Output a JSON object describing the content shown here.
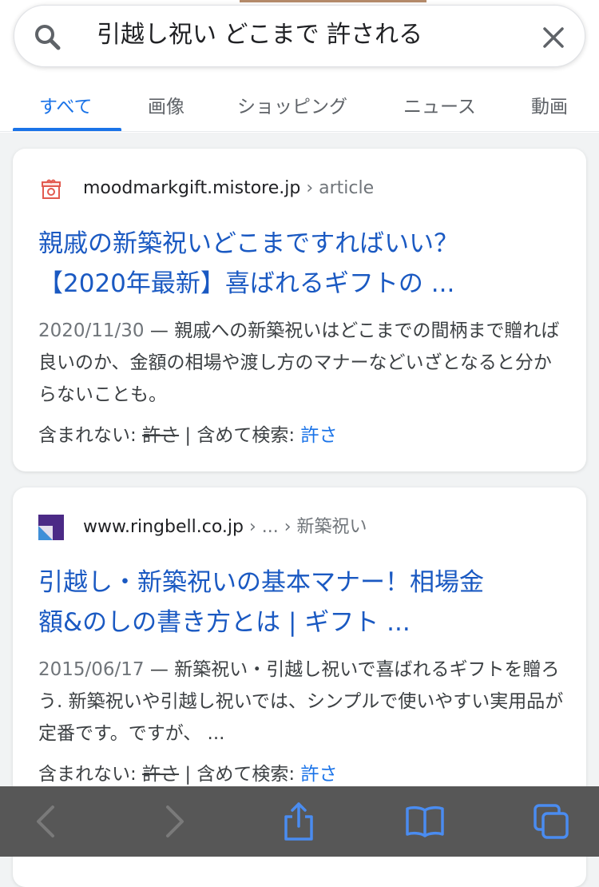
{
  "search": {
    "query": "引越し祝い どこまで 許される"
  },
  "tabs": [
    {
      "label": "すべて"
    },
    {
      "label": "画像"
    },
    {
      "label": "ショッピング"
    },
    {
      "label": "ニュース"
    },
    {
      "label": "動画"
    }
  ],
  "results": [
    {
      "domain": "moodmarkgift.mistore.jp",
      "path": " › article",
      "title_line1": "親戚の新築祝いどこまですればいい？",
      "title_line2": "【2020年最新】喜ばれるギフトの ...",
      "date": "2020/11/30",
      "snippet": "親戚への新築祝いはどこまでの間柄まで贈れば良いのか、金額の相場や渡し方のマナーなどいざとなると分からないことも。",
      "missing_label": "含まれない: ",
      "missing_term": "許さ",
      "include_label": " | 含めて検索: ",
      "include_term": "許さ"
    },
    {
      "domain": "www.ringbell.co.jp",
      "path": " › ... › 新築祝い",
      "title_line1": "引越し・新築祝いの基本マナー！相場金",
      "title_line2": "額&のしの書き方とは | ギフト ...",
      "date": "2015/06/17",
      "snippet": "新築祝い・引越し祝いで喜ばれるギフトを贈ろう. 新築祝いや引越し祝いでは、シンプルで使いやすい実用品が定番です。ですが、 ...",
      "missing_label": "含まれない: ",
      "missing_term": "許さ",
      "include_label": " | 含めて検索: ",
      "include_term": "許さ"
    }
  ],
  "colors": {
    "accent": "#1a73e8",
    "title_link": "#1a59c2",
    "toolbar_bg": "#575757",
    "toolbar_icon": "#4a8cf0"
  },
  "icons": {
    "search": "search-icon",
    "clear": "close-icon",
    "back": "back-arrow-icon",
    "forward": "forward-arrow-icon",
    "share": "share-icon",
    "bookmarks": "book-icon",
    "tabs": "tabs-icon"
  }
}
